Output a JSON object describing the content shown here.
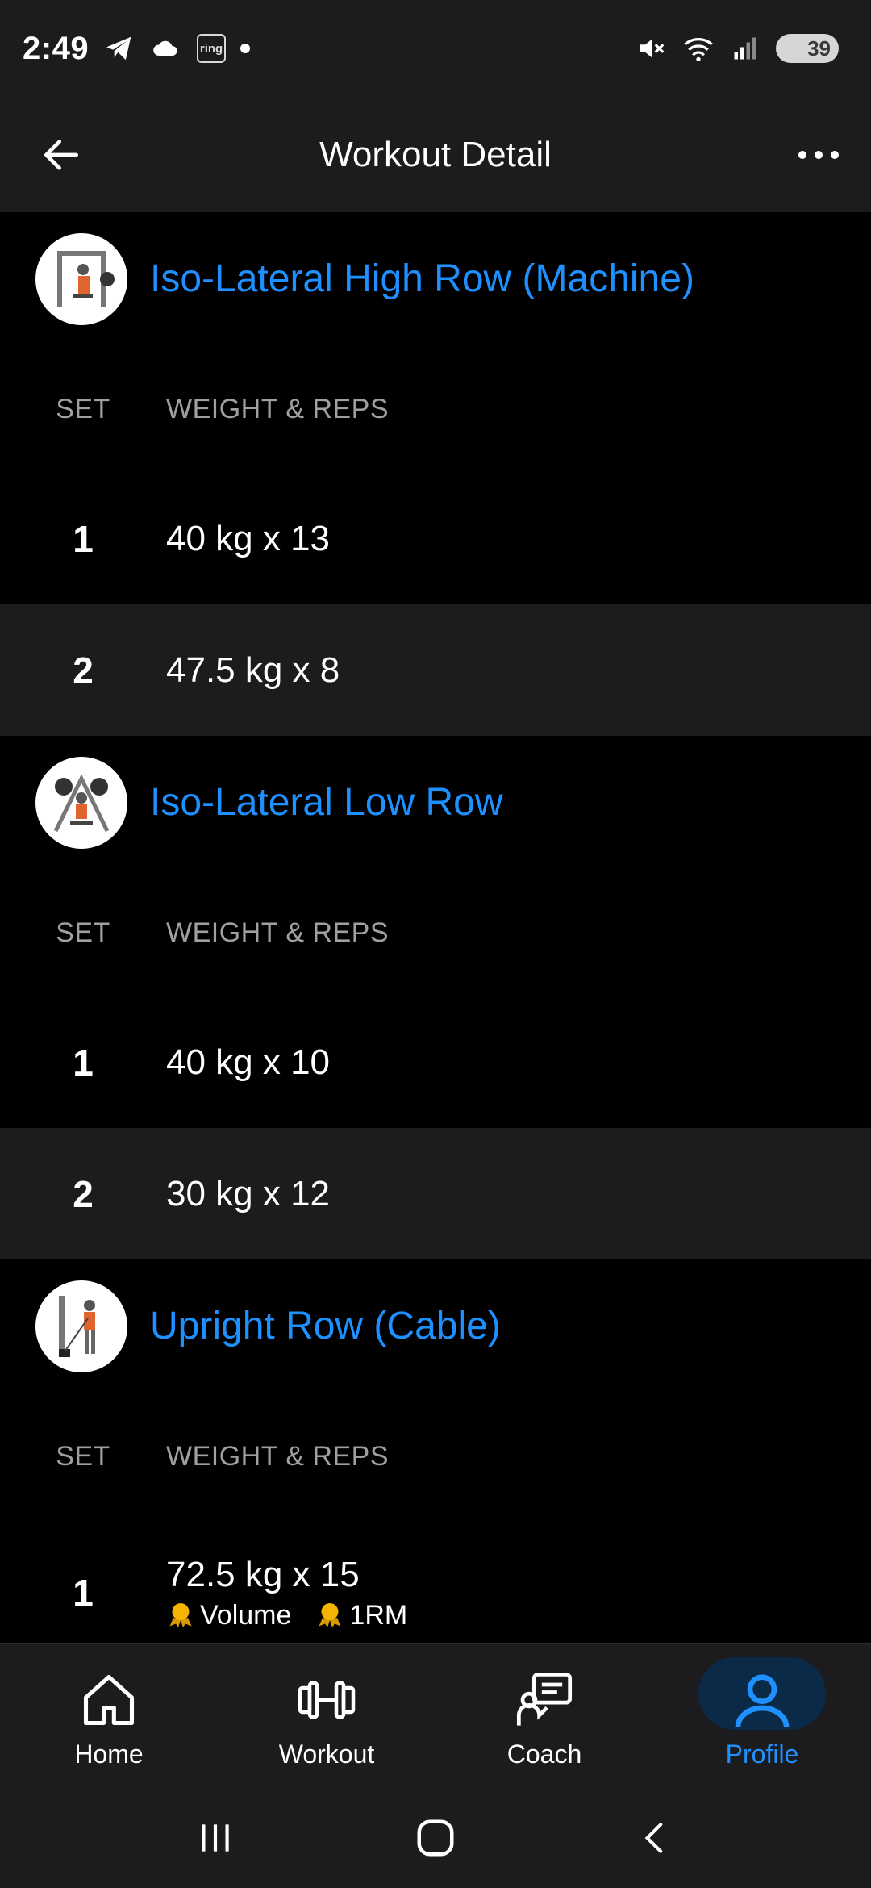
{
  "status_bar": {
    "time": "2:49",
    "ring_label": "ring",
    "battery": "39"
  },
  "app_bar": {
    "title": "Workout Detail"
  },
  "columns": {
    "set": "SET",
    "weight_reps": "WEIGHT & REPS"
  },
  "exercises": [
    {
      "name": "Iso-Lateral High Row (Machine)",
      "sets": [
        {
          "num": "1",
          "value": "40 kg x 13"
        },
        {
          "num": "2",
          "value": "47.5 kg x 8"
        }
      ]
    },
    {
      "name": "Iso-Lateral Low Row",
      "sets": [
        {
          "num": "1",
          "value": "40 kg x 10"
        },
        {
          "num": "2",
          "value": "30 kg x 12"
        }
      ]
    },
    {
      "name": "Upright Row (Cable)",
      "sets": [
        {
          "num": "1",
          "value": "72.5 kg x 15",
          "badges": [
            "Volume",
            "1RM"
          ]
        }
      ]
    }
  ],
  "bottom_nav": {
    "items": [
      {
        "label": "Home",
        "icon": "home-icon"
      },
      {
        "label": "Workout",
        "icon": "dumbbell-icon"
      },
      {
        "label": "Coach",
        "icon": "coach-icon"
      },
      {
        "label": "Profile",
        "icon": "profile-icon",
        "active": true
      }
    ]
  },
  "colors": {
    "accent": "#1e90ff",
    "bar_bg": "#1c1c1e",
    "row_alt": "#1c1c1e",
    "medal": "#f5b400"
  }
}
